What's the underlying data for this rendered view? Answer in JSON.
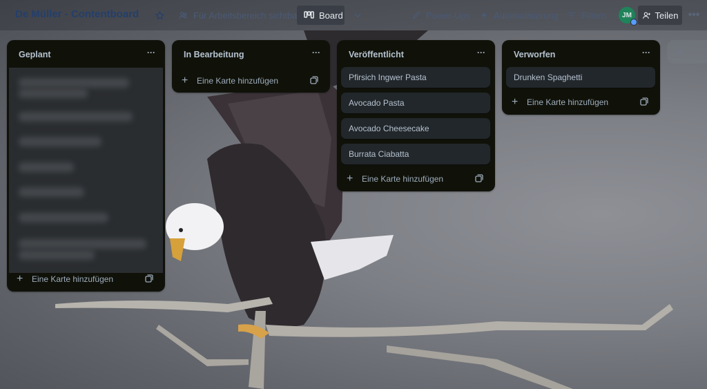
{
  "header": {
    "board_title": "De Müller - Contentboard",
    "star_icon": "star-icon",
    "visibility_label": "Für Arbeitsbereich sichtbar",
    "view_label": "Board",
    "powerups_label": "Power-Ups",
    "automation_label": "Automatisierung",
    "filter_label": "Filtern",
    "avatar_initials": "JM",
    "share_label": "Teilen"
  },
  "lists": [
    {
      "title": "Geplant",
      "cards": [],
      "add_card_label": "Eine Karte hinzufügen"
    },
    {
      "title": "In Bearbeitung",
      "cards": [],
      "add_card_label": "Eine Karte hinzufügen"
    },
    {
      "title": "Veröffentlicht",
      "cards": [
        "Pfirsich Ingwer Pasta",
        "Avocado Pasta",
        "Avocado Cheesecake",
        "Burrata Ciabatta"
      ],
      "add_card_label": "Eine Karte hinzufügen"
    },
    {
      "title": "Verworfen",
      "cards": [
        "Drunken Spaghetti"
      ],
      "add_card_label": "Eine Karte hinzufügen"
    }
  ],
  "colors": {
    "list_bg": "#10120a",
    "card_bg": "#22272b",
    "text": "#b6c2cf",
    "title_color": "#243f6b",
    "avatar_bg": "#1f845a"
  }
}
